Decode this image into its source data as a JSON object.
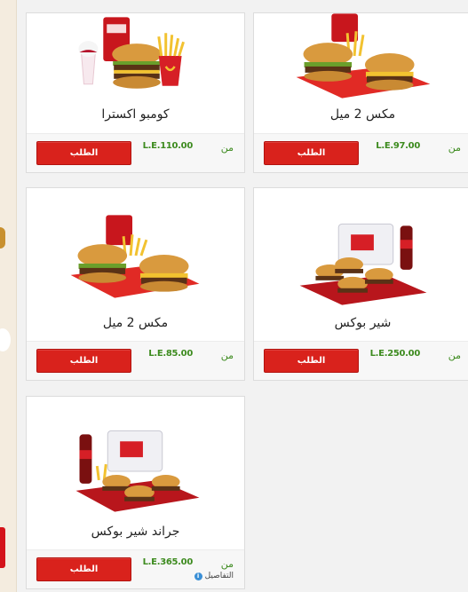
{
  "menu_items": [
    {
      "name": "كومبو اكسترا",
      "price": "L.E.110.00",
      "price_prefix": "من",
      "button_label": "الطلب"
    },
    {
      "name": "مكس 2 ميل",
      "price": "L.E.97.00",
      "price_prefix": "من",
      "button_label": "الطلب"
    },
    {
      "name": "مكس 2 ميل",
      "price": "L.E.85.00",
      "price_prefix": "من",
      "button_label": "الطلب"
    },
    {
      "name": "شير بوكس",
      "price": "L.E.250.00",
      "price_prefix": "من",
      "button_label": "الطلب"
    },
    {
      "name": "جراند شير بوكس",
      "price": "L.E.365.00",
      "price_prefix": "من",
      "button_label": "الطلب",
      "details_label": "التفاصيل"
    }
  ],
  "colors": {
    "order_button": "#d9221c",
    "price_text": "#3d8b1f",
    "page_background": "#f2f2f2",
    "card_background": "#ffffff"
  }
}
